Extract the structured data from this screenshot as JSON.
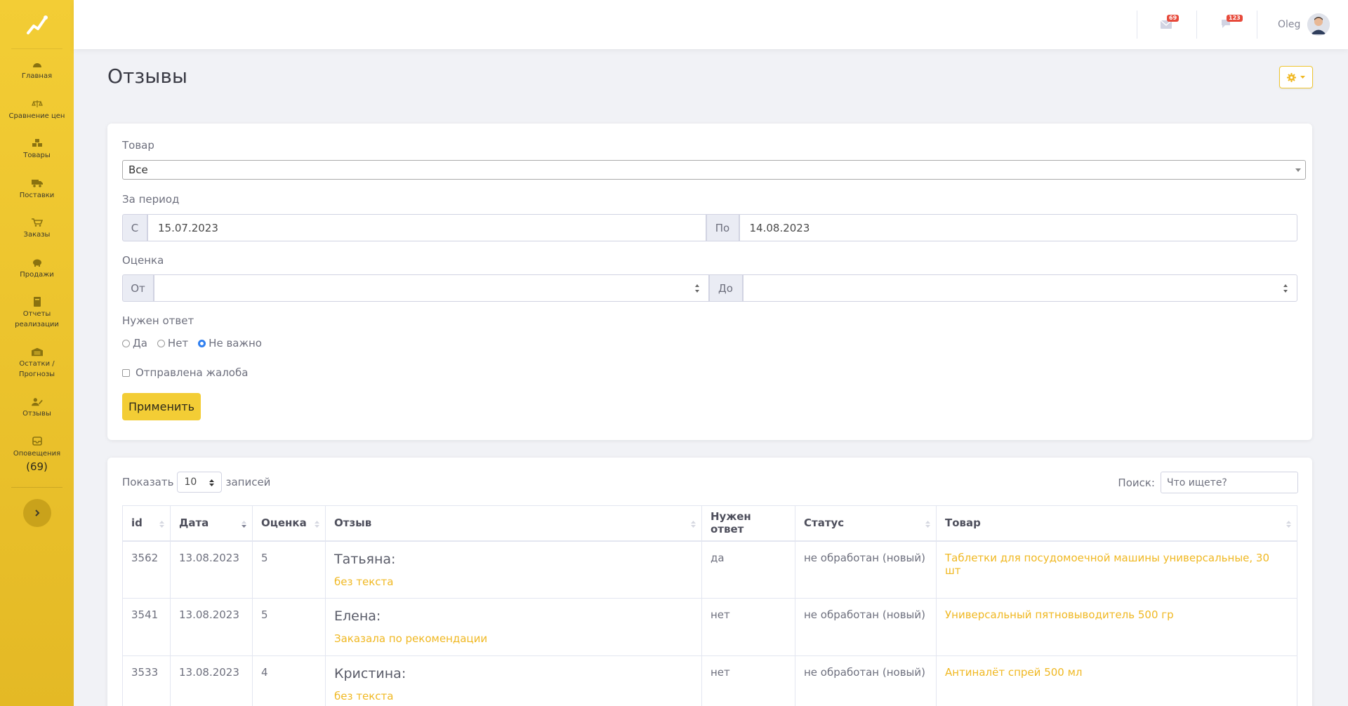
{
  "topbar": {
    "messages_count": "69",
    "alerts_count": "123",
    "user_name": "Oleg"
  },
  "sidebar": {
    "items": [
      {
        "label": "Главная",
        "icon": "speedometer-icon"
      },
      {
        "label": "Сравнение цен",
        "icon": "balance-scale-icon"
      },
      {
        "label": "Товары",
        "icon": "boxes-icon"
      },
      {
        "label": "Поставки",
        "icon": "truck-icon"
      },
      {
        "label": "Заказы",
        "icon": "cart-icon"
      },
      {
        "label": "Продажи",
        "icon": "piggy-bank-icon"
      },
      {
        "label": "Отчеты реализации",
        "icon": "book-icon"
      },
      {
        "label": "Остатки / Прогнозы",
        "icon": "warehouse-icon"
      },
      {
        "label": "Отзывы",
        "icon": "user-edit-icon"
      },
      {
        "label": "Оповещения",
        "icon": "inbox-icon",
        "count": "(69)"
      }
    ]
  },
  "page": {
    "title": "Отзывы"
  },
  "filters": {
    "product_label": "Товар",
    "product_value": "Все",
    "period_label": "За период",
    "from_prefix": "С",
    "date_from": "15.07.2023",
    "to_prefix": "По",
    "date_to": "14.08.2023",
    "rating_label": "Оценка",
    "rating_from_prefix": "От",
    "rating_to_prefix": "До",
    "need_answer_label": "Нужен ответ",
    "radio_yes": "Да",
    "radio_no": "Нет",
    "radio_any": "Не важно",
    "complaint_label": "Отправлена жалоба",
    "apply_label": "Применить"
  },
  "table_controls": {
    "show_label": "Показать",
    "page_length": "10",
    "entries_label": "записей",
    "search_label": "Поиск:",
    "search_placeholder": "Что ищете?"
  },
  "table": {
    "headers": [
      "id",
      "Дата",
      "Оценка",
      "Отзыв",
      "Нужен ответ",
      "Статус",
      "Товар"
    ],
    "rows": [
      {
        "id": "3562",
        "date": "13.08.2023",
        "rating": "5",
        "author": "Татьяна:",
        "text": "без текста",
        "need_answer": "да",
        "status": "не обработан (новый)",
        "product": "Таблетки для посудомоечной машины универсальные, 30 шт"
      },
      {
        "id": "3541",
        "date": "13.08.2023",
        "rating": "5",
        "author": "Елена:",
        "text": "Заказала по рекомендации",
        "need_answer": "нет",
        "status": "не обработан (новый)",
        "product": "Универсальный пятновыводитель 500 гр"
      },
      {
        "id": "3533",
        "date": "13.08.2023",
        "rating": "4",
        "author": "Кристина:",
        "text": "без текста",
        "need_answer": "нет",
        "status": "не обработан (новый)",
        "product": "Антиналёт спрей 500 мл"
      }
    ]
  },
  "colors": {
    "accent": "#f3cd35",
    "link": "#f0b822",
    "badge": "#e74a3b"
  }
}
